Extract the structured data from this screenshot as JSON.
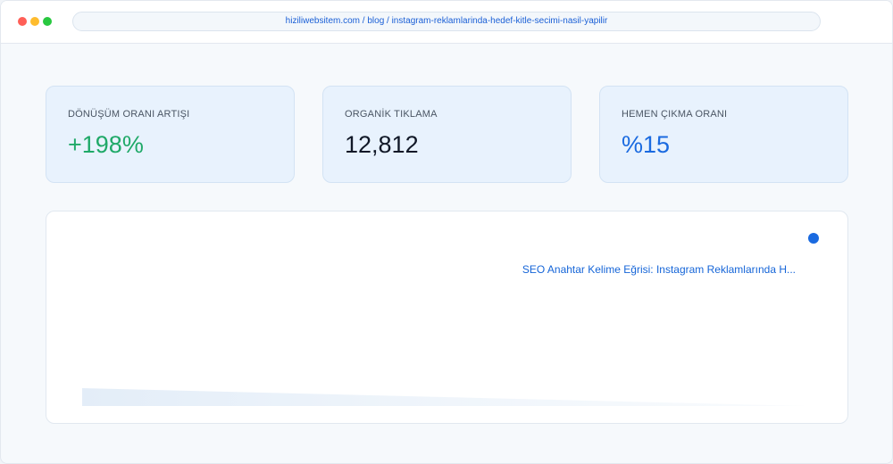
{
  "browser": {
    "url": "hiziliwebsitem.com / blog / instagram-reklamlarinda-hedef-kitle-secimi-nasil-yapilir"
  },
  "stats": [
    {
      "label": "DÖNÜŞÜM ORANI ARTIŞI",
      "value": "+198%",
      "color": "#1fa968"
    },
    {
      "label": "ORGANİK TIKLAMA",
      "value": "12,812",
      "color": "#111827"
    },
    {
      "label": "HEMEN ÇIKMA ORANI",
      "value": "%15",
      "color": "#1a6ae0"
    }
  ],
  "chart": {
    "title": "SEO Anahtar Kelime Eğrisi: Instagram Reklamlarında H...",
    "accent_color": "#1a6ae0"
  },
  "chart_data": {
    "type": "area",
    "title": "SEO Anahtar Kelime Eğrisi: Instagram Reklamlarında H...",
    "x": [
      0,
      1,
      2,
      3,
      4,
      5,
      6,
      7,
      8,
      9,
      10
    ],
    "series": [
      {
        "values": [
          20,
          18,
          16,
          14,
          12,
          10,
          8,
          6,
          4,
          2,
          0
        ]
      }
    ],
    "ylim": [
      0,
      100
    ],
    "grid": false
  }
}
